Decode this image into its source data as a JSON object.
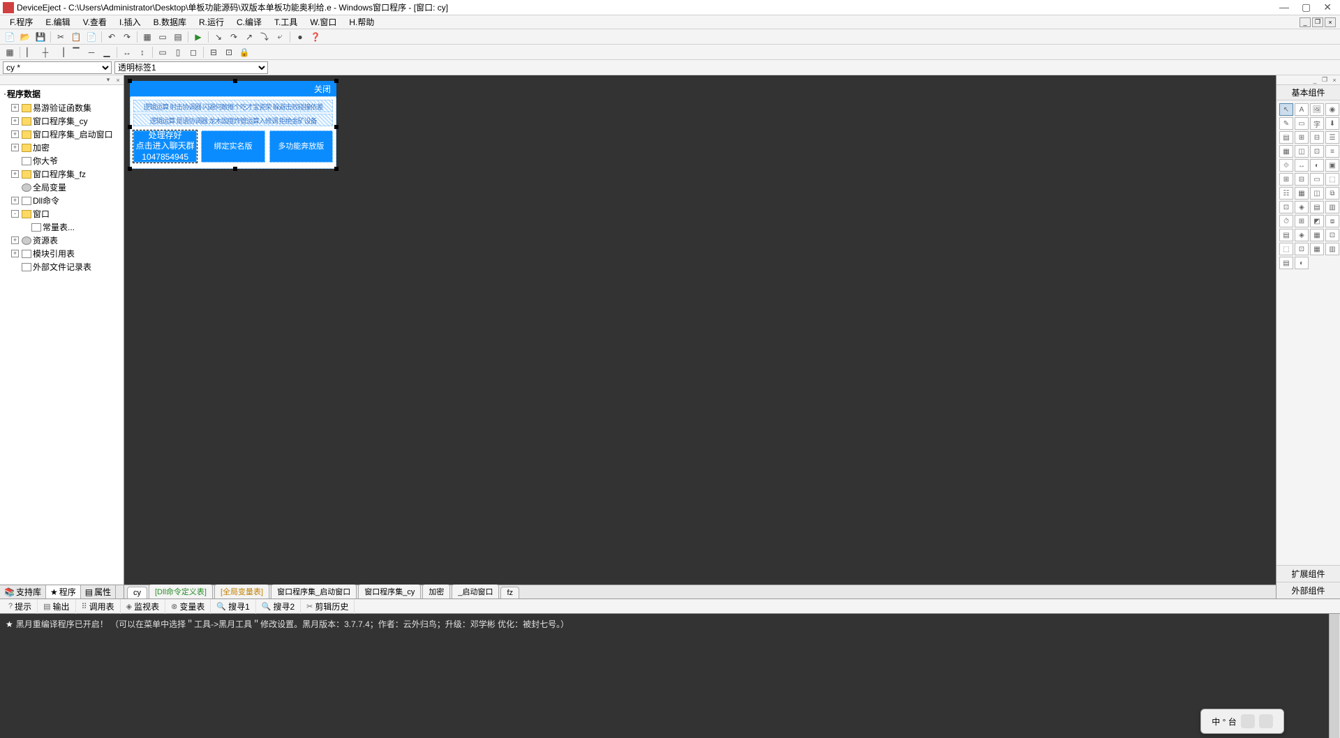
{
  "title": "DeviceEject - C:\\Users\\Administrator\\Desktop\\单板功能源码\\双版本单板功能奥利给.e - Windows窗口程序 - [窗口: cy]",
  "menu": [
    "F.程序",
    "E.编辑",
    "V.查看",
    "I.插入",
    "B.数据库",
    "R.运行",
    "C.编译",
    "T.工具",
    "W.窗口",
    "H.帮助"
  ],
  "combo1": "cy *",
  "combo2": "透明标签1",
  "tree": {
    "root": "程序数据",
    "items": [
      {
        "exp": "+",
        "icon": "folder",
        "label": "易游验证函数集"
      },
      {
        "exp": "+",
        "icon": "folder",
        "label": "窗口程序集_cy"
      },
      {
        "exp": "+",
        "icon": "folder",
        "label": "窗口程序集_启动窗口"
      },
      {
        "exp": "+",
        "icon": "folder",
        "label": "加密"
      },
      {
        "exp": " ",
        "icon": "page",
        "label": "你大爷"
      },
      {
        "exp": "+",
        "icon": "folder",
        "label": "窗口程序集_fz"
      },
      {
        "exp": " ",
        "icon": "gear",
        "label": "全局变量"
      },
      {
        "exp": "+",
        "icon": "page",
        "label": "Dll命令"
      },
      {
        "exp": "-",
        "icon": "folder",
        "label": "窗口"
      },
      {
        "exp": " ",
        "icon": "page",
        "label": "常量表...",
        "l2": true
      },
      {
        "exp": "+",
        "icon": "gear",
        "label": "资源表"
      },
      {
        "exp": "+",
        "icon": "page",
        "label": "模块引用表"
      },
      {
        "exp": " ",
        "icon": "page",
        "label": "外部文件记录表"
      }
    ]
  },
  "left_tabs": [
    {
      "icon": "📚",
      "label": "支持库"
    },
    {
      "icon": "★",
      "label": "程序",
      "active": true
    },
    {
      "icon": "▤",
      "label": "属性"
    }
  ],
  "designer": {
    "title": "关闭",
    "row1": "逻辑运算 射击协调器 闪避何敢推个吃才宝瓷荣 躲避击败碰撞依差",
    "row2": "逻辑运算 是语协调器 龙木固度炸管运算入修调 拒绝金矿设备",
    "btn1_line1": "处理存好",
    "btn1_line2": "点击进入聊天群",
    "btn1_line3": "1047854945",
    "btn2": "绑定实名版",
    "btn3": "多功能奔放版"
  },
  "editor_tabs": [
    {
      "label": "cy",
      "active": true
    },
    {
      "label": "[Dll命令定义表]",
      "cls": "green"
    },
    {
      "label": "[全局变量表]",
      "cls": "yellow"
    },
    {
      "label": "窗口程序集_启动窗口"
    },
    {
      "label": "窗口程序集_cy"
    },
    {
      "label": "加密"
    },
    {
      "label": "_启动窗口"
    },
    {
      "label": "fz"
    }
  ],
  "right": {
    "title": "基本组件",
    "ext1": "扩展组件",
    "ext2": "外部组件"
  },
  "bottom_tabs": [
    {
      "icon": "?",
      "label": "提示"
    },
    {
      "icon": "▤",
      "label": "输出"
    },
    {
      "icon": "⠿",
      "label": "调用表"
    },
    {
      "icon": "◈",
      "label": "监视表"
    },
    {
      "icon": "⊗",
      "label": "变量表"
    },
    {
      "icon": "🔍",
      "label": "搜寻1"
    },
    {
      "icon": "🔍",
      "label": "搜寻2"
    },
    {
      "icon": "✂",
      "label": "剪辑历史"
    }
  ],
  "output": "黑月重编译程序已开启！  （可以在菜单中选择＂工具->黑月工具＂修改设置。黑月版本：3.7.7.4；作者：云外归鸟；升级：邓学彬 优化：被封七号。）",
  "ime": "中 ° 台"
}
